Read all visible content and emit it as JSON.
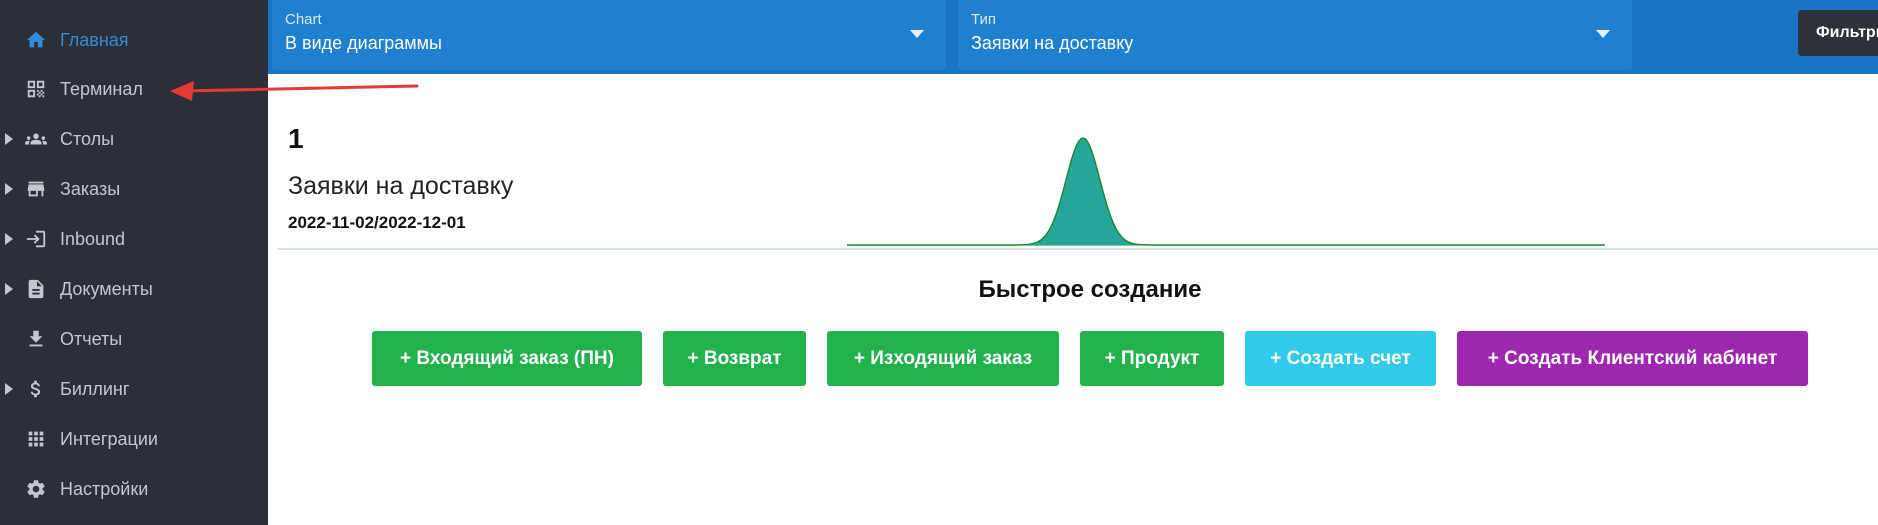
{
  "sidebar": {
    "items": [
      {
        "label": "Главная",
        "icon": "home-icon"
      },
      {
        "label": "Терминал",
        "icon": "qr-code-icon"
      },
      {
        "label": "Столы",
        "icon": "people-icon"
      },
      {
        "label": "Заказы",
        "icon": "store-icon"
      },
      {
        "label": "Inbound",
        "icon": "login-icon"
      },
      {
        "label": "Документы",
        "icon": "document-icon"
      },
      {
        "label": "Отчеты",
        "icon": "download-icon"
      },
      {
        "label": "Биллинг",
        "icon": "dollar-icon"
      },
      {
        "label": "Интеграции",
        "icon": "apps-grid-icon"
      },
      {
        "label": "Настройки",
        "icon": "gear-icon"
      }
    ],
    "active_item": "Главная"
  },
  "topbar": {
    "chart_select": {
      "label": "Chart",
      "value": "В виде диаграммы"
    },
    "type_select": {
      "label": "Тип",
      "value": "Заявки на доставку"
    },
    "filter_button": "Фильтры"
  },
  "summary": {
    "count": "1",
    "title": "Заявки на доставку",
    "date_range": "2022-11-02/2022-12-01"
  },
  "quick_create": {
    "title": "Быстрое создание",
    "buttons": [
      {
        "label": "+ Входящий заказ (ПН)",
        "color": "#22b14c"
      },
      {
        "label": "+ Возврат",
        "color": "#22b14c"
      },
      {
        "label": "+ Изходящий заказ",
        "color": "#22b14c"
      },
      {
        "label": "+ Продукт",
        "color": "#22b14c"
      },
      {
        "label": "+ Создать счет",
        "color": "#33c9e8"
      },
      {
        "label": "+ Создать Клиентский кабинет",
        "color": "#9e27b0"
      }
    ]
  },
  "colors": {
    "sidebar_bg": "#2b3038",
    "topbar_bg": "#1a74c5",
    "active": "#2f8ddb",
    "chart_fill": "#26a69a",
    "chart_stroke": "#1b8a2f",
    "annotation_arrow": "#e53935"
  }
}
